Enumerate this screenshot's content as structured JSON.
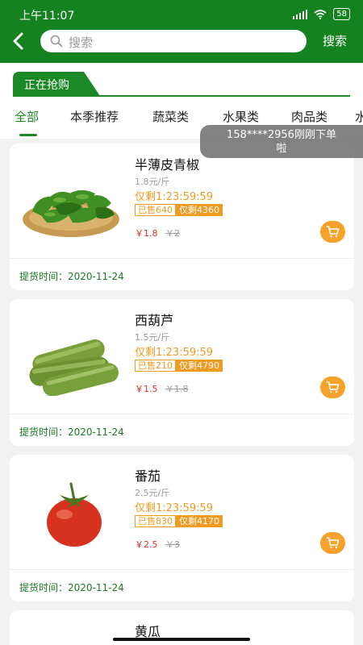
{
  "status_bar": {
    "time": "上午11:07",
    "battery": "58"
  },
  "header": {
    "search_placeholder": "搜索",
    "search_button": "搜索"
  },
  "section": {
    "title": "正在抢购"
  },
  "categories": [
    {
      "label": "全部",
      "active": true
    },
    {
      "label": "本季推荐"
    },
    {
      "label": "蔬菜类"
    },
    {
      "label": "水果类"
    },
    {
      "label": "肉品类"
    },
    {
      "label": "水"
    }
  ],
  "toast": {
    "line1": "158****2956刚刚下单",
    "line2": "啦"
  },
  "products": [
    {
      "name": "半薄皮青椒",
      "unit_price": "1.8元/斤",
      "countdown": "仅剩1:23:59:59",
      "sold": "已售640",
      "left": "仅剩4360",
      "price": "￥1.8",
      "original_price": "￥2",
      "pickup": "提货时间：2020-11-24"
    },
    {
      "name": "西葫芦",
      "unit_price": "1.5元/斤",
      "countdown": "仅剩1:23:59:59",
      "sold": "已售210",
      "left": "仅剩4790",
      "price": "￥1.5",
      "original_price": "￥1.8",
      "pickup": "提货时间：2020-11-24"
    },
    {
      "name": "番茄",
      "unit_price": "2.5元/斤",
      "countdown": "仅剩1:23:59:59",
      "sold": "已售830",
      "left": "仅剩4170",
      "price": "￥2.5",
      "original_price": "￥3",
      "pickup": "提货时间：2020-11-24"
    },
    {
      "name": "黄瓜"
    }
  ],
  "colors": {
    "brand_green": "#14821f",
    "accent_orange": "#ef9b21",
    "price_red": "#d6302b"
  }
}
